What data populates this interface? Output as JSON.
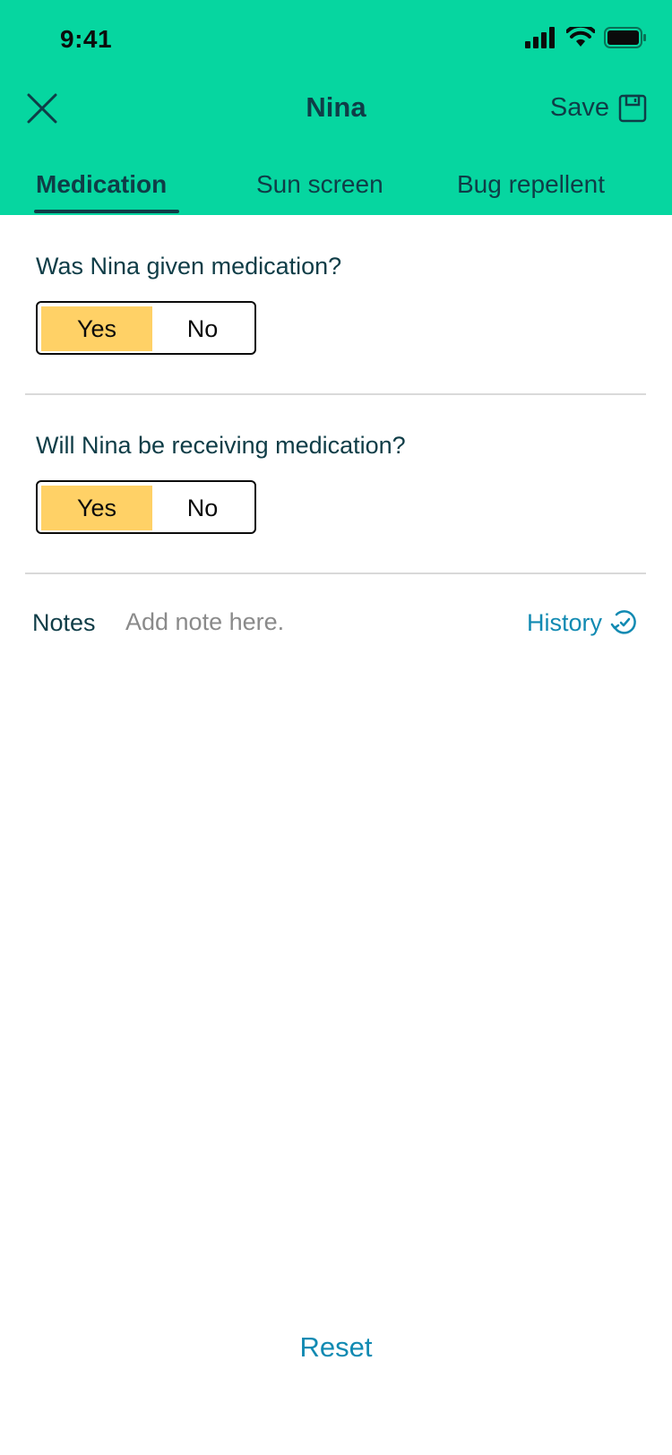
{
  "status_bar": {
    "time": "9:41"
  },
  "header": {
    "title": "Nina",
    "save_label": "Save",
    "colors": {
      "background": "#06D6A0",
      "text": "#0F3D47"
    }
  },
  "tabs": [
    {
      "label": "Medication",
      "active": true
    },
    {
      "label": "Sun screen",
      "active": false
    },
    {
      "label": "Bug repellent",
      "active": false
    }
  ],
  "questions": [
    {
      "label": "Was Nina given medication?",
      "yes": "Yes",
      "no": "No",
      "selected": "Yes"
    },
    {
      "label": "Will Nina be receiving medication?",
      "yes": "Yes",
      "no": "No",
      "selected": "Yes"
    }
  ],
  "notes": {
    "label": "Notes",
    "placeholder": "Add note here.",
    "value": ""
  },
  "history_label": "History",
  "reset_label": "Reset",
  "colors": {
    "accent_selected": "#FFD166",
    "link": "#118AB2",
    "divider": "#d9d9d9"
  },
  "icons": [
    "close-icon",
    "save-icon",
    "history-icon",
    "signal-icon",
    "wifi-icon",
    "battery-icon"
  ]
}
